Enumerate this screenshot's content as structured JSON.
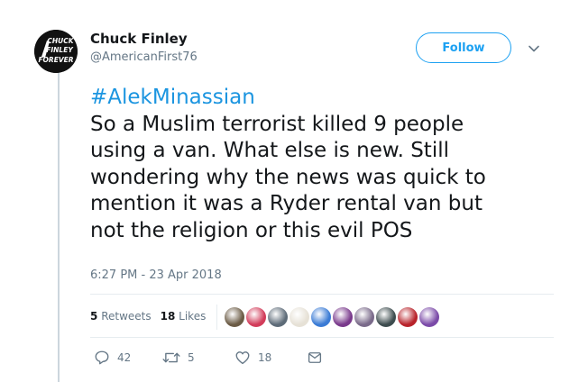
{
  "author": {
    "name": "Chuck Finley",
    "handle": "@AmericanFirst76",
    "avatar_text": [
      "CHUCK",
      "FINLEY",
      "FOREVER"
    ]
  },
  "follow_label": "Follow",
  "tweet": {
    "hashtag": "#AlekMinassian",
    "lines": [
      "So a Muslim terrorist killed 9 people",
      "using a van. What else is new. Still",
      "wondering why the news was quick to",
      "mention it was a Ryder rental van but",
      "not the religion or this evil POS"
    ],
    "timestamp": "6:27 PM - 23 Apr 2018"
  },
  "stats": {
    "retweets_count": "5",
    "retweets_label": "Retweets",
    "likes_count": "18",
    "likes_label": "Likes"
  },
  "liker_colors": [
    "#6b5b45",
    "#d23c5a",
    "#5d6b78",
    "#e6e1d6",
    "#3a7bd5",
    "#7a3a8c",
    "#7a6a8a",
    "#3d4c4e",
    "#b8232b",
    "#7b4aa8"
  ],
  "actions": {
    "reply_count": "42",
    "retweet_count": "5",
    "like_count": "18"
  },
  "colors": {
    "accent": "#1da1f2",
    "hashtag": "#1b95e0",
    "muted": "#657786",
    "text": "#14171a"
  }
}
